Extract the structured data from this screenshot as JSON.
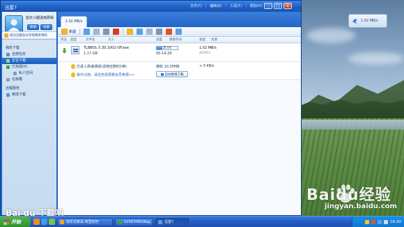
{
  "app": {
    "title": "迅雷7",
    "menu": [
      "文件(F)",
      "编辑(E)",
      "工具(T)",
      "帮助(H)"
    ],
    "window_controls": [
      "_",
      "□",
      "x"
    ]
  },
  "profile": {
    "greeting": "蓝灰斗趣迷雨那缘",
    "login_label": "登录",
    "register_label": "注册",
    "vip_promo": "成为迅雷会员享受尊贵特权"
  },
  "nav": {
    "my_downloads": "我的下载",
    "all_tasks": "全部任务",
    "downloading": "正在下载",
    "completed": "已完成(0)",
    "private_space": "私人空间",
    "trash": "垃圾箱",
    "remote_header": "远程服务",
    "offline_download": "离线下载"
  },
  "tab": {
    "label": "1.02 MB/s"
  },
  "toolbar": {
    "new_label": "新建"
  },
  "columns": [
    "状态",
    "类型",
    "文件名",
    "大小",
    "进度",
    "剩余时间",
    "速度",
    "资源"
  ],
  "task": {
    "filename": "TLBBOL-3.30.1002-OF.exe",
    "size": "1.17 GB",
    "progress_percent": 26.5,
    "progress_text": "26.5%",
    "remaining_time": "00:14:29",
    "speed": "1.02 MB/s",
    "peers": "42/913"
  },
  "accel": {
    "status": "已进入高速通道(试用还剩8分钟)",
    "link": "我共马骑，请任务投限量会员券费>>",
    "received": "接收 10.35MB",
    "speed": "+ 0 KB/s",
    "offline_button": "启动离线下载"
  },
  "float_widget": {
    "speed": "1.02 MB/s"
  },
  "taskbar": {
    "start_label": "开始",
    "buttons": [
      "快乐式家具-阿里旺旺",
      "5258708508qq",
      "迅雷7"
    ],
    "clock": "16:30"
  },
  "watermark": {
    "brand": "Baidu经验",
    "url": "jingyan.baidu.com",
    "left_text": "Bai du 下载吧"
  },
  "colors": {
    "titlebar": "#1f5fc4",
    "accent_blue": "#2a7fd6",
    "delete_red": "#d63a2a",
    "vip_orange": "#e6502a"
  }
}
